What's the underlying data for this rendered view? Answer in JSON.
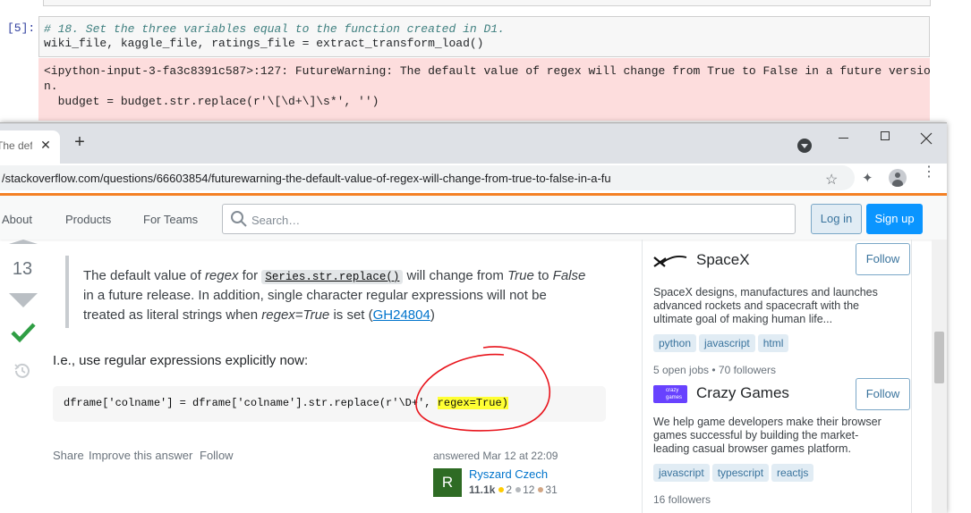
{
  "notebook": {
    "prompt": "[5]:",
    "comment_line": "# 18. Set the three variables equal to the function created in D1.",
    "code_line": "wiki_file, kaggle_file, ratings_file = extract_transform_load()",
    "warning_line1": "<ipython-input-3-fa3c8391c587>:127: FutureWarning: The default value of regex will change from True to False in a future versio",
    "warning_line2": "n.",
    "warning_line3": "  budget = budget.str.replace(r'\\[\\d+\\]\\s*', '')"
  },
  "browser": {
    "tab_title": "The def",
    "close_tab": "✕",
    "new_tab": "+",
    "url": "/stackoverflow.com/questions/66603854/futurewarning-the-default-value-of-regex-will-change-from-true-to-false-in-a-fu",
    "star": "☆",
    "extension": "✦",
    "menu": "⋮"
  },
  "so_header": {
    "nav": [
      "About",
      "Products",
      "For Teams"
    ],
    "search_placeholder": "Search…",
    "login": "Log in",
    "signup": "Sign up"
  },
  "answer": {
    "votes": "13",
    "quote_parts": {
      "l1_a": "The default value of ",
      "l1_b": "regex",
      "l1_c": " for ",
      "l1_code": "Series.str.replace()",
      "l1_d": " will change from ",
      "l1_e": "True",
      "l1_f": " to ",
      "l1_g": "False",
      "l2": "in a future release. In addition, single character regular expressions will not be",
      "l3_a": "treated as literal strings when ",
      "l3_b": "regex=True",
      "l3_c": " is set (",
      "l3_link": "GH24804",
      "l3_d": ")"
    },
    "text": "I.e., use regular expressions explicitly now:",
    "code_before": "dframe['colname'] = dframe['colname'].str.replace(r'\\D+', ",
    "code_highlight": "regex=True)",
    "post_menu": [
      "Share",
      "Improve this answer",
      "Follow"
    ],
    "answered": "answered Mar 12 at 22:09",
    "user": {
      "initial": "R",
      "name": "Ryszard Czech",
      "rep": "11.1k",
      "gold": "2",
      "silver": "12",
      "bronze": "31"
    }
  },
  "sidebar": {
    "companies": [
      {
        "name": "SpaceX",
        "follow": "Follow",
        "desc_lines": [
          "SpaceX designs, manufactures and launches",
          "advanced rockets and spacecraft with the",
          "ultimate goal of making human life..."
        ],
        "tags": [
          "python",
          "javascript",
          "html"
        ],
        "meta": "5 open jobs • 70 followers"
      },
      {
        "name": "Crazy Games",
        "follow": "Follow",
        "logo_text": "crazy games",
        "desc_lines": [
          "We help game developers make their browser",
          "games successful by building the market-",
          "leading casual browser games platform."
        ],
        "tags": [
          "javascript",
          "typescript",
          "reactjs"
        ],
        "meta": "16 followers"
      }
    ]
  },
  "colors": {
    "so_orange": "#f48024",
    "so_blue": "#0a95ff",
    "link_blue": "#0074cc",
    "accepted_green": "#2f9e44",
    "warning_bg": "#fddddd",
    "highlight_yellow": "#ffff33",
    "annotation_red": "#e8141c"
  }
}
